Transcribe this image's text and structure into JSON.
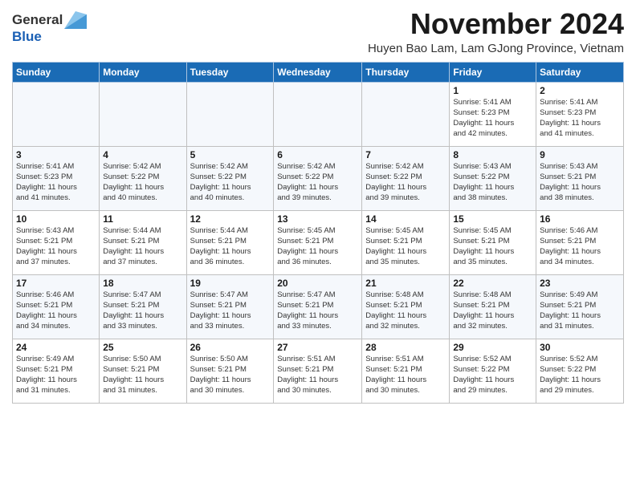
{
  "header": {
    "logo_general": "General",
    "logo_blue": "Blue",
    "month_title": "November 2024",
    "subtitle": "Huyen Bao Lam, Lam GJong Province, Vietnam"
  },
  "days_of_week": [
    "Sunday",
    "Monday",
    "Tuesday",
    "Wednesday",
    "Thursday",
    "Friday",
    "Saturday"
  ],
  "weeks": [
    [
      {
        "day": "",
        "info": ""
      },
      {
        "day": "",
        "info": ""
      },
      {
        "day": "",
        "info": ""
      },
      {
        "day": "",
        "info": ""
      },
      {
        "day": "",
        "info": ""
      },
      {
        "day": "1",
        "info": "Sunrise: 5:41 AM\nSunset: 5:23 PM\nDaylight: 11 hours\nand 42 minutes."
      },
      {
        "day": "2",
        "info": "Sunrise: 5:41 AM\nSunset: 5:23 PM\nDaylight: 11 hours\nand 41 minutes."
      }
    ],
    [
      {
        "day": "3",
        "info": "Sunrise: 5:41 AM\nSunset: 5:23 PM\nDaylight: 11 hours\nand 41 minutes."
      },
      {
        "day": "4",
        "info": "Sunrise: 5:42 AM\nSunset: 5:22 PM\nDaylight: 11 hours\nand 40 minutes."
      },
      {
        "day": "5",
        "info": "Sunrise: 5:42 AM\nSunset: 5:22 PM\nDaylight: 11 hours\nand 40 minutes."
      },
      {
        "day": "6",
        "info": "Sunrise: 5:42 AM\nSunset: 5:22 PM\nDaylight: 11 hours\nand 39 minutes."
      },
      {
        "day": "7",
        "info": "Sunrise: 5:42 AM\nSunset: 5:22 PM\nDaylight: 11 hours\nand 39 minutes."
      },
      {
        "day": "8",
        "info": "Sunrise: 5:43 AM\nSunset: 5:22 PM\nDaylight: 11 hours\nand 38 minutes."
      },
      {
        "day": "9",
        "info": "Sunrise: 5:43 AM\nSunset: 5:21 PM\nDaylight: 11 hours\nand 38 minutes."
      }
    ],
    [
      {
        "day": "10",
        "info": "Sunrise: 5:43 AM\nSunset: 5:21 PM\nDaylight: 11 hours\nand 37 minutes."
      },
      {
        "day": "11",
        "info": "Sunrise: 5:44 AM\nSunset: 5:21 PM\nDaylight: 11 hours\nand 37 minutes."
      },
      {
        "day": "12",
        "info": "Sunrise: 5:44 AM\nSunset: 5:21 PM\nDaylight: 11 hours\nand 36 minutes."
      },
      {
        "day": "13",
        "info": "Sunrise: 5:45 AM\nSunset: 5:21 PM\nDaylight: 11 hours\nand 36 minutes."
      },
      {
        "day": "14",
        "info": "Sunrise: 5:45 AM\nSunset: 5:21 PM\nDaylight: 11 hours\nand 35 minutes."
      },
      {
        "day": "15",
        "info": "Sunrise: 5:45 AM\nSunset: 5:21 PM\nDaylight: 11 hours\nand 35 minutes."
      },
      {
        "day": "16",
        "info": "Sunrise: 5:46 AM\nSunset: 5:21 PM\nDaylight: 11 hours\nand 34 minutes."
      }
    ],
    [
      {
        "day": "17",
        "info": "Sunrise: 5:46 AM\nSunset: 5:21 PM\nDaylight: 11 hours\nand 34 minutes."
      },
      {
        "day": "18",
        "info": "Sunrise: 5:47 AM\nSunset: 5:21 PM\nDaylight: 11 hours\nand 33 minutes."
      },
      {
        "day": "19",
        "info": "Sunrise: 5:47 AM\nSunset: 5:21 PM\nDaylight: 11 hours\nand 33 minutes."
      },
      {
        "day": "20",
        "info": "Sunrise: 5:47 AM\nSunset: 5:21 PM\nDaylight: 11 hours\nand 33 minutes."
      },
      {
        "day": "21",
        "info": "Sunrise: 5:48 AM\nSunset: 5:21 PM\nDaylight: 11 hours\nand 32 minutes."
      },
      {
        "day": "22",
        "info": "Sunrise: 5:48 AM\nSunset: 5:21 PM\nDaylight: 11 hours\nand 32 minutes."
      },
      {
        "day": "23",
        "info": "Sunrise: 5:49 AM\nSunset: 5:21 PM\nDaylight: 11 hours\nand 31 minutes."
      }
    ],
    [
      {
        "day": "24",
        "info": "Sunrise: 5:49 AM\nSunset: 5:21 PM\nDaylight: 11 hours\nand 31 minutes."
      },
      {
        "day": "25",
        "info": "Sunrise: 5:50 AM\nSunset: 5:21 PM\nDaylight: 11 hours\nand 31 minutes."
      },
      {
        "day": "26",
        "info": "Sunrise: 5:50 AM\nSunset: 5:21 PM\nDaylight: 11 hours\nand 30 minutes."
      },
      {
        "day": "27",
        "info": "Sunrise: 5:51 AM\nSunset: 5:21 PM\nDaylight: 11 hours\nand 30 minutes."
      },
      {
        "day": "28",
        "info": "Sunrise: 5:51 AM\nSunset: 5:21 PM\nDaylight: 11 hours\nand 30 minutes."
      },
      {
        "day": "29",
        "info": "Sunrise: 5:52 AM\nSunset: 5:22 PM\nDaylight: 11 hours\nand 29 minutes."
      },
      {
        "day": "30",
        "info": "Sunrise: 5:52 AM\nSunset: 5:22 PM\nDaylight: 11 hours\nand 29 minutes."
      }
    ]
  ]
}
